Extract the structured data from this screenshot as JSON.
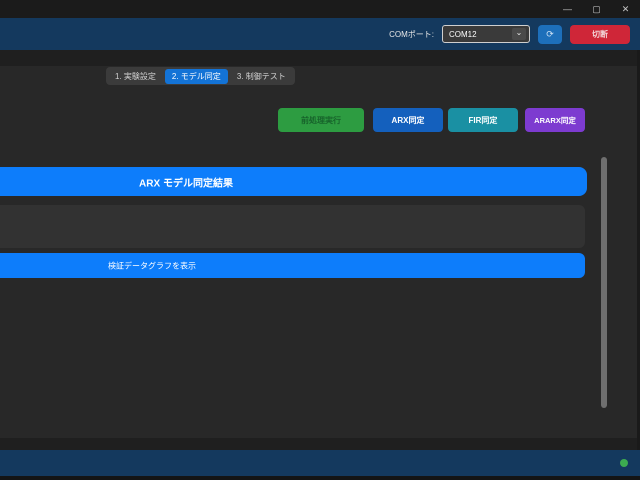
{
  "titlebar": {
    "minimize_icon": "—",
    "maximize_icon": "▢",
    "close_icon": "✕"
  },
  "header": {
    "com_port_label": "COMポート:",
    "com_port_value": "COM12",
    "chevron_icon": "⌄",
    "refresh_icon": "⟳",
    "disconnect_label": "切断"
  },
  "tabs": [
    {
      "label": "1. 実験設定"
    },
    {
      "label": "2. モデル同定"
    },
    {
      "label": "3. 制御テスト"
    }
  ],
  "active_tab_index": 1,
  "actions": [
    {
      "label": "前処理実行",
      "color": "#2d9c41",
      "enabled": false
    },
    {
      "label": "ARX同定",
      "color": "#1460bd",
      "enabled": true
    },
    {
      "label": "FIR同定",
      "color": "#1a90a3",
      "enabled": true
    },
    {
      "label": "ARARX同定",
      "color": "#7d3bd0",
      "enabled": true
    }
  ],
  "results": {
    "banner_title": "ARX モデル同定結果",
    "result_text": "",
    "show_graph_label": "検証データグラフを表示"
  },
  "status": {
    "connection_ok": true
  },
  "colors": {
    "titlebar_bg": "#1b1b1b",
    "header_bg": "#14395e",
    "content_bg": "#282828",
    "tab_container_bg": "#3b3b3b",
    "active_tab_blue": "#1373d6",
    "accent_blue": "#0d7dfb",
    "disconnect_red": "#cf2638",
    "refresh_blue": "#1d6fba",
    "status_green": "#3cab50",
    "scrollbar_gray": "#6f6f6f"
  }
}
